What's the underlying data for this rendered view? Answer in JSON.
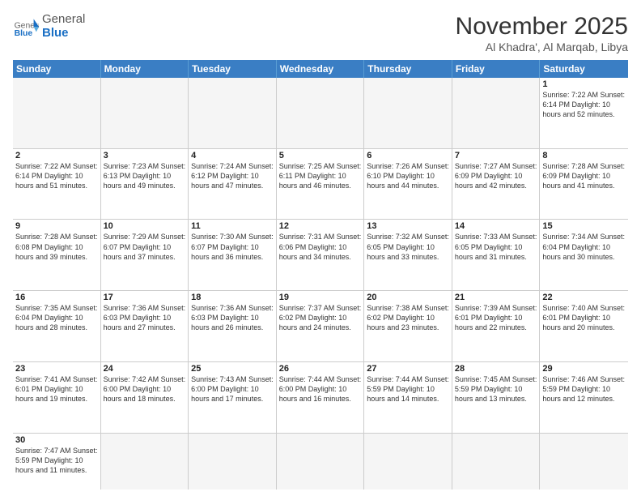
{
  "header": {
    "logo_general": "General",
    "logo_blue": "Blue",
    "month_title": "November 2025",
    "location": "Al Khadra', Al Marqab, Libya"
  },
  "days_of_week": [
    "Sunday",
    "Monday",
    "Tuesday",
    "Wednesday",
    "Thursday",
    "Friday",
    "Saturday"
  ],
  "weeks": [
    [
      {
        "day": "",
        "info": ""
      },
      {
        "day": "",
        "info": ""
      },
      {
        "day": "",
        "info": ""
      },
      {
        "day": "",
        "info": ""
      },
      {
        "day": "",
        "info": ""
      },
      {
        "day": "",
        "info": ""
      },
      {
        "day": "1",
        "info": "Sunrise: 7:22 AM\nSunset: 6:14 PM\nDaylight: 10 hours\nand 52 minutes."
      }
    ],
    [
      {
        "day": "2",
        "info": "Sunrise: 7:22 AM\nSunset: 6:14 PM\nDaylight: 10 hours\nand 51 minutes."
      },
      {
        "day": "3",
        "info": "Sunrise: 7:23 AM\nSunset: 6:13 PM\nDaylight: 10 hours\nand 49 minutes."
      },
      {
        "day": "4",
        "info": "Sunrise: 7:24 AM\nSunset: 6:12 PM\nDaylight: 10 hours\nand 47 minutes."
      },
      {
        "day": "5",
        "info": "Sunrise: 7:25 AM\nSunset: 6:11 PM\nDaylight: 10 hours\nand 46 minutes."
      },
      {
        "day": "6",
        "info": "Sunrise: 7:26 AM\nSunset: 6:10 PM\nDaylight: 10 hours\nand 44 minutes."
      },
      {
        "day": "7",
        "info": "Sunrise: 7:27 AM\nSunset: 6:09 PM\nDaylight: 10 hours\nand 42 minutes."
      },
      {
        "day": "8",
        "info": "Sunrise: 7:28 AM\nSunset: 6:09 PM\nDaylight: 10 hours\nand 41 minutes."
      }
    ],
    [
      {
        "day": "9",
        "info": "Sunrise: 7:28 AM\nSunset: 6:08 PM\nDaylight: 10 hours\nand 39 minutes."
      },
      {
        "day": "10",
        "info": "Sunrise: 7:29 AM\nSunset: 6:07 PM\nDaylight: 10 hours\nand 37 minutes."
      },
      {
        "day": "11",
        "info": "Sunrise: 7:30 AM\nSunset: 6:07 PM\nDaylight: 10 hours\nand 36 minutes."
      },
      {
        "day": "12",
        "info": "Sunrise: 7:31 AM\nSunset: 6:06 PM\nDaylight: 10 hours\nand 34 minutes."
      },
      {
        "day": "13",
        "info": "Sunrise: 7:32 AM\nSunset: 6:05 PM\nDaylight: 10 hours\nand 33 minutes."
      },
      {
        "day": "14",
        "info": "Sunrise: 7:33 AM\nSunset: 6:05 PM\nDaylight: 10 hours\nand 31 minutes."
      },
      {
        "day": "15",
        "info": "Sunrise: 7:34 AM\nSunset: 6:04 PM\nDaylight: 10 hours\nand 30 minutes."
      }
    ],
    [
      {
        "day": "16",
        "info": "Sunrise: 7:35 AM\nSunset: 6:04 PM\nDaylight: 10 hours\nand 28 minutes."
      },
      {
        "day": "17",
        "info": "Sunrise: 7:36 AM\nSunset: 6:03 PM\nDaylight: 10 hours\nand 27 minutes."
      },
      {
        "day": "18",
        "info": "Sunrise: 7:36 AM\nSunset: 6:03 PM\nDaylight: 10 hours\nand 26 minutes."
      },
      {
        "day": "19",
        "info": "Sunrise: 7:37 AM\nSunset: 6:02 PM\nDaylight: 10 hours\nand 24 minutes."
      },
      {
        "day": "20",
        "info": "Sunrise: 7:38 AM\nSunset: 6:02 PM\nDaylight: 10 hours\nand 23 minutes."
      },
      {
        "day": "21",
        "info": "Sunrise: 7:39 AM\nSunset: 6:01 PM\nDaylight: 10 hours\nand 22 minutes."
      },
      {
        "day": "22",
        "info": "Sunrise: 7:40 AM\nSunset: 6:01 PM\nDaylight: 10 hours\nand 20 minutes."
      }
    ],
    [
      {
        "day": "23",
        "info": "Sunrise: 7:41 AM\nSunset: 6:01 PM\nDaylight: 10 hours\nand 19 minutes."
      },
      {
        "day": "24",
        "info": "Sunrise: 7:42 AM\nSunset: 6:00 PM\nDaylight: 10 hours\nand 18 minutes."
      },
      {
        "day": "25",
        "info": "Sunrise: 7:43 AM\nSunset: 6:00 PM\nDaylight: 10 hours\nand 17 minutes."
      },
      {
        "day": "26",
        "info": "Sunrise: 7:44 AM\nSunset: 6:00 PM\nDaylight: 10 hours\nand 16 minutes."
      },
      {
        "day": "27",
        "info": "Sunrise: 7:44 AM\nSunset: 5:59 PM\nDaylight: 10 hours\nand 14 minutes."
      },
      {
        "day": "28",
        "info": "Sunrise: 7:45 AM\nSunset: 5:59 PM\nDaylight: 10 hours\nand 13 minutes."
      },
      {
        "day": "29",
        "info": "Sunrise: 7:46 AM\nSunset: 5:59 PM\nDaylight: 10 hours\nand 12 minutes."
      }
    ],
    [
      {
        "day": "30",
        "info": "Sunrise: 7:47 AM\nSunset: 5:59 PM\nDaylight: 10 hours\nand 11 minutes."
      },
      {
        "day": "",
        "info": ""
      },
      {
        "day": "",
        "info": ""
      },
      {
        "day": "",
        "info": ""
      },
      {
        "day": "",
        "info": ""
      },
      {
        "day": "",
        "info": ""
      },
      {
        "day": "",
        "info": ""
      }
    ]
  ]
}
